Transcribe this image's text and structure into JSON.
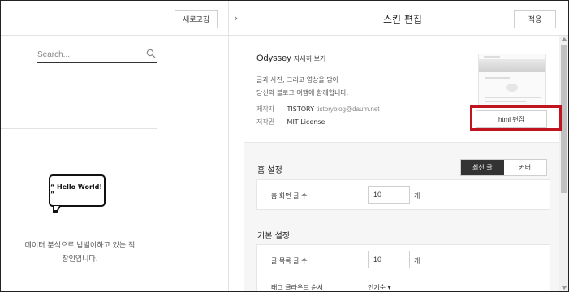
{
  "left_pane": {
    "refresh_label": "새로고침",
    "search_placeholder": "Search...",
    "bubble_text": "“ Hello World! ”",
    "bio_line1": "데이터 분석으로 밥벌이하고 있는 직",
    "bio_line2": "장인입니다."
  },
  "toggle": {
    "arrow": "›"
  },
  "header": {
    "title": "스킨 편집",
    "apply_label": "적용"
  },
  "skin": {
    "name": "Odyssey",
    "detail_link": "자세히 보기",
    "desc_line1": "글과 사진, 그리고 영상을 담아",
    "desc_line2": "당신의 블로그 여행에 함께합니다.",
    "author_key": "제작자",
    "author_name": "TISTORY",
    "author_email": "tistoryblog@daum.net",
    "license_key": "저작권",
    "license_value": "MIT License",
    "html_edit_label": "html 편집"
  },
  "home_settings": {
    "title": "홈 설정",
    "tabs": [
      "최신 글",
      "커버"
    ],
    "active_tab": "최신 글",
    "posts_label": "홈 화면 글 수",
    "posts_value": "10",
    "unit": "개"
  },
  "basic_settings": {
    "title": "기본 설정",
    "list_label": "글 목록 글 수",
    "list_value": "10",
    "unit": "개",
    "tagcloud_label": "태그 클라우드 순서",
    "tagcloud_value": "인기순 ▾"
  },
  "colors": {
    "highlight": "#c0141e",
    "active_tab": "#333333"
  }
}
